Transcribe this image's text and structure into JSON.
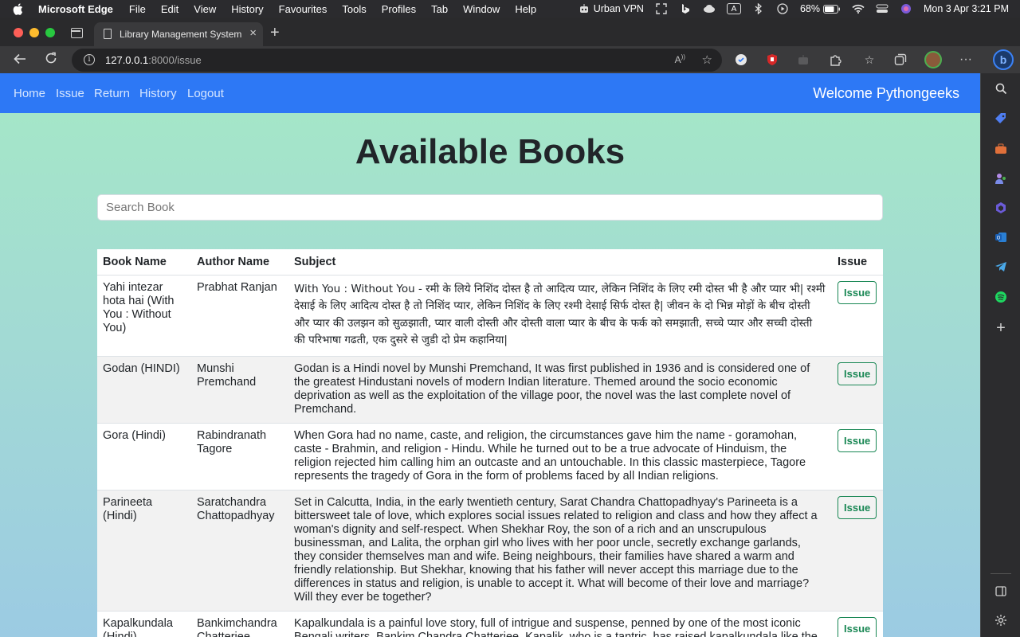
{
  "menubar": {
    "app_name": "Microsoft Edge",
    "items": [
      "File",
      "Edit",
      "View",
      "History",
      "Favourites",
      "Tools",
      "Profiles",
      "Tab",
      "Window",
      "Help"
    ],
    "vpn_label": "Urban VPN",
    "battery": "68%",
    "datetime": "Mon 3 Apr  3:21 PM"
  },
  "browser": {
    "tab_title": "Library Management System",
    "url_host": "127.0.0.1",
    "url_rest": ":8000/issue"
  },
  "navbar": {
    "links": [
      "Home",
      "Issue",
      "Return",
      "History",
      "Logout"
    ],
    "welcome": "Welcome Pythongeeks"
  },
  "main": {
    "title": "Available Books",
    "search_placeholder": "Search Book"
  },
  "table": {
    "headers": [
      "Book Name",
      "Author Name",
      "Subject",
      "Issue"
    ],
    "issue_label": "Issue",
    "rows": [
      {
        "book": "Yahi intezar hota hai (With You : Without You)",
        "author": "Prabhat Ranjan",
        "subject": "With You : Without You - रमी के लिये निशिंद दोस्त है तो आदित्य प्यार, लेकिन निशिंद के लिए रमी दोस्त भी है और प्यार भी| रश्मी देसाई के लिए आदित्य दोस्त है तो निशिंद प्यार, लेकिन निशिंद के लिए रश्मी देसाई सिर्फ दोस्त है| जीवन के दो भिन्न मोड़ों के बीच दोस्ती और प्यार की उलझन को सुळझाती, प्यार वाली दोस्ती और दोस्ती वाला प्यार के बीच के फर्क को समझाती, सच्चे प्यार और सच्ची दोस्ती की परिभाषा गढती, एक दुसरे से जुडी दो प्रेम कहानिया|"
      },
      {
        "book": "Godan (HINDI)",
        "author": "Munshi Premchand",
        "subject": "Godan is a Hindi novel by Munshi Premchand, It was first published in 1936 and is considered one of the greatest Hindustani novels of modern Indian literature. Themed around the socio economic deprivation as well as the exploitation of the village poor, the novel was the last complete novel of Premchand."
      },
      {
        "book": "Gora (Hindi)",
        "author": "Rabindranath Tagore",
        "subject": "When Gora had no name, caste, and religion, the circumstances gave him the name - goramohan, caste - Brahmin, and religion - Hindu. While he turned out to be a true advocate of Hinduism, the religion rejected him calling him an outcaste and an untouchable. In this classic masterpiece, Tagore represents the tragedy of Gora in the form of problems faced by all Indian religions."
      },
      {
        "book": "Parineeta (Hindi)",
        "author": "Saratchandra Chattopadhyay",
        "subject": "Set in Calcutta, India, in the early twentieth century, Sarat Chandra Chattopadhyay's Parineeta is a bittersweet tale of love, which explores social issues related to religion and class and how they affect a woman's dignity and self-respect. When Shekhar Roy, the son of a rich and an unscrupulous businessman, and Lalita, the orphan girl who lives with her poor uncle, secretly exchange garlands, they consider themselves man and wife. Being neighbours, their families have shared a warm and friendly relationship. But Shekhar, knowing that his father will never accept this marriage due to the differences in status and religion, is unable to accept it. What will become of their love and marriage? Will they ever be together?"
      },
      {
        "book": "Kapalkundala (Hindi)",
        "author": "Bankimchandra Chatterjee",
        "subject": "Kapalkundala is a painful love story, full of intrigue and suspense, penned by one of the most iconic Bengali writers, Bankim Chandra Chatterjee. Kapalik, who is a tantric, has raised kapalkundala like the"
      }
    ]
  }
}
